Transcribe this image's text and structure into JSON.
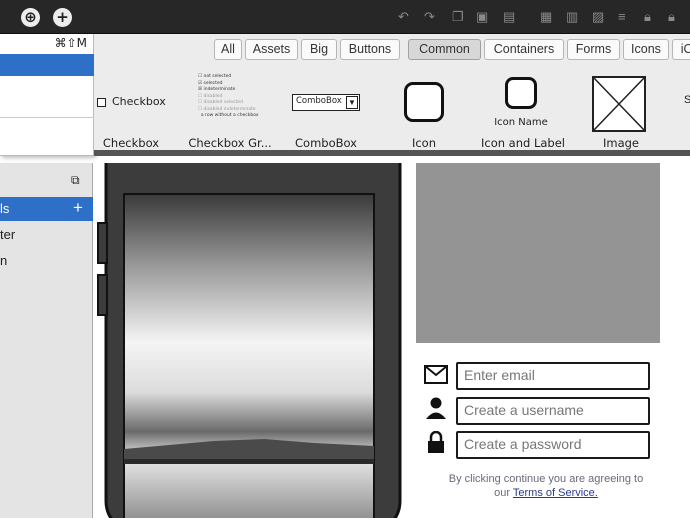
{
  "dropdown": {
    "shortcut": "⌘⇧M"
  },
  "tabs": [
    "All",
    "Assets",
    "Big",
    "Buttons",
    "Common",
    "Containers",
    "Forms",
    "Icons",
    "iO"
  ],
  "active_tab": "Common",
  "components": {
    "checkbox_preview": "Checkbox",
    "checkbox_group_items": [
      "not selected",
      "selected",
      "indeterminate",
      "disabled",
      "disabled selected",
      "disabled indeterminate",
      "a row without a checkbox"
    ],
    "combobox_preview": "ComboBox",
    "icon_label_preview": "Icon Name",
    "labels": [
      "Checkbox",
      "Checkbox Gr...",
      "ComboBox",
      "Icon",
      "Icon and Label",
      "Image"
    ],
    "partial_next": "S"
  },
  "sidebar": {
    "items": [
      "ls",
      "ter",
      "n"
    ],
    "add_glyph": "+"
  },
  "form": {
    "email_placeholder": "Enter email",
    "username_placeholder": "Create a username",
    "password_placeholder": "Create a password",
    "terms_text": "By clicking continue you are agreeing to",
    "terms_prefix": "our",
    "terms_link": "Terms of Service."
  },
  "colors": {
    "accent": "#2e6fc8",
    "toolbar": "#272727"
  }
}
